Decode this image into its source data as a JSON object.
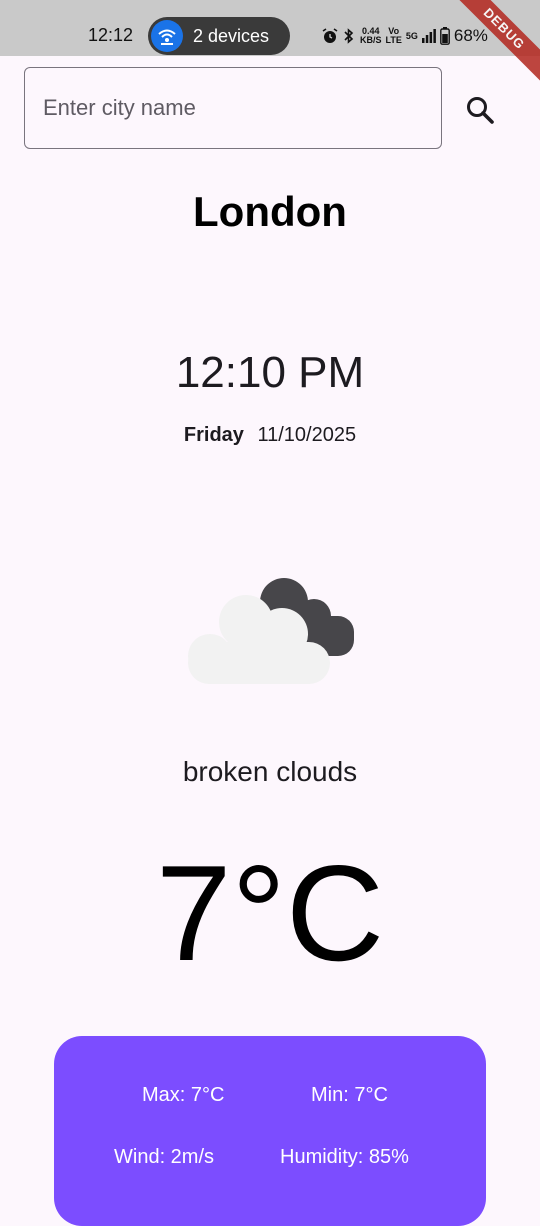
{
  "status_bar": {
    "time": "12:12",
    "devices": "2 devices",
    "net_speed": "0.44",
    "net_unit": "KB/S",
    "volte_top": "Vo",
    "volte_bottom": "LTE",
    "network": "5G",
    "battery": "68%"
  },
  "debug_banner": "DEBUG",
  "search": {
    "placeholder": "Enter city name",
    "value": ""
  },
  "weather": {
    "city": "London",
    "time": "12:10 PM",
    "weekday": "Friday",
    "date": "11/10/2025",
    "icon": "broken-clouds-icon",
    "condition": "broken clouds",
    "temperature": "7°C"
  },
  "details": {
    "max": "Max: 7°C",
    "min": "Min: 7°C",
    "wind": "Wind: 2m/s",
    "humidity": "Humidity: 85%"
  },
  "colors": {
    "background": "#fdf7fd",
    "card": "#7c4dff",
    "status_bar": "#c9c9c9"
  }
}
